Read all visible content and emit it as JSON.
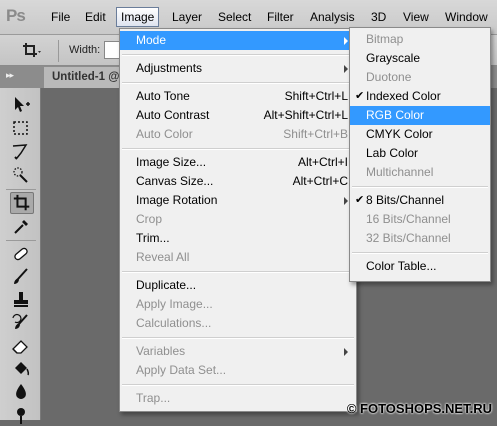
{
  "app_logo": "Ps",
  "menubar": [
    "File",
    "Edit",
    "Image",
    "Layer",
    "Select",
    "Filter",
    "Analysis",
    "3D",
    "View",
    "Window"
  ],
  "options_bar": {
    "width_label": "Width:"
  },
  "document_tab": "Untitled-1 @",
  "image_menu": {
    "groups": [
      [
        {
          "label": "Mode",
          "highlighted": true,
          "submenu": true
        }
      ],
      [
        {
          "label": "Adjustments",
          "submenu": true
        }
      ],
      [
        {
          "label": "Auto Tone",
          "shortcut": "Shift+Ctrl+L"
        },
        {
          "label": "Auto Contrast",
          "shortcut": "Alt+Shift+Ctrl+L"
        },
        {
          "label": "Auto Color",
          "shortcut": "Shift+Ctrl+B",
          "disabled": true
        }
      ],
      [
        {
          "label": "Image Size...",
          "shortcut": "Alt+Ctrl+I"
        },
        {
          "label": "Canvas Size...",
          "shortcut": "Alt+Ctrl+C"
        },
        {
          "label": "Image Rotation",
          "submenu": true
        },
        {
          "label": "Crop",
          "disabled": true
        },
        {
          "label": "Trim..."
        },
        {
          "label": "Reveal All",
          "disabled": true
        }
      ],
      [
        {
          "label": "Duplicate..."
        },
        {
          "label": "Apply Image...",
          "disabled": true
        },
        {
          "label": "Calculations...",
          "disabled": true
        }
      ],
      [
        {
          "label": "Variables",
          "disabled": true,
          "submenu": true
        },
        {
          "label": "Apply Data Set...",
          "disabled": true
        }
      ],
      [
        {
          "label": "Trap...",
          "disabled": true
        }
      ]
    ]
  },
  "mode_submenu": {
    "groups": [
      [
        {
          "label": "Bitmap",
          "disabled": true
        },
        {
          "label": "Grayscale"
        },
        {
          "label": "Duotone",
          "disabled": true
        },
        {
          "label": "Indexed Color",
          "checked": true
        },
        {
          "label": "RGB Color",
          "highlighted": true
        },
        {
          "label": "CMYK Color"
        },
        {
          "label": "Lab Color"
        },
        {
          "label": "Multichannel",
          "disabled": true
        }
      ],
      [
        {
          "label": "8 Bits/Channel",
          "checked": true
        },
        {
          "label": "16 Bits/Channel",
          "disabled": true
        },
        {
          "label": "32 Bits/Channel",
          "disabled": true
        }
      ],
      [
        {
          "label": "Color Table..."
        }
      ]
    ]
  },
  "watermark": "© FOTOSHOPS.NET.RU",
  "colors": {
    "highlight": "#3399ff",
    "menu_bg": "#f0f0f0",
    "disabled_text": "#8f8f8f",
    "workspace": "#6a6a6a"
  }
}
